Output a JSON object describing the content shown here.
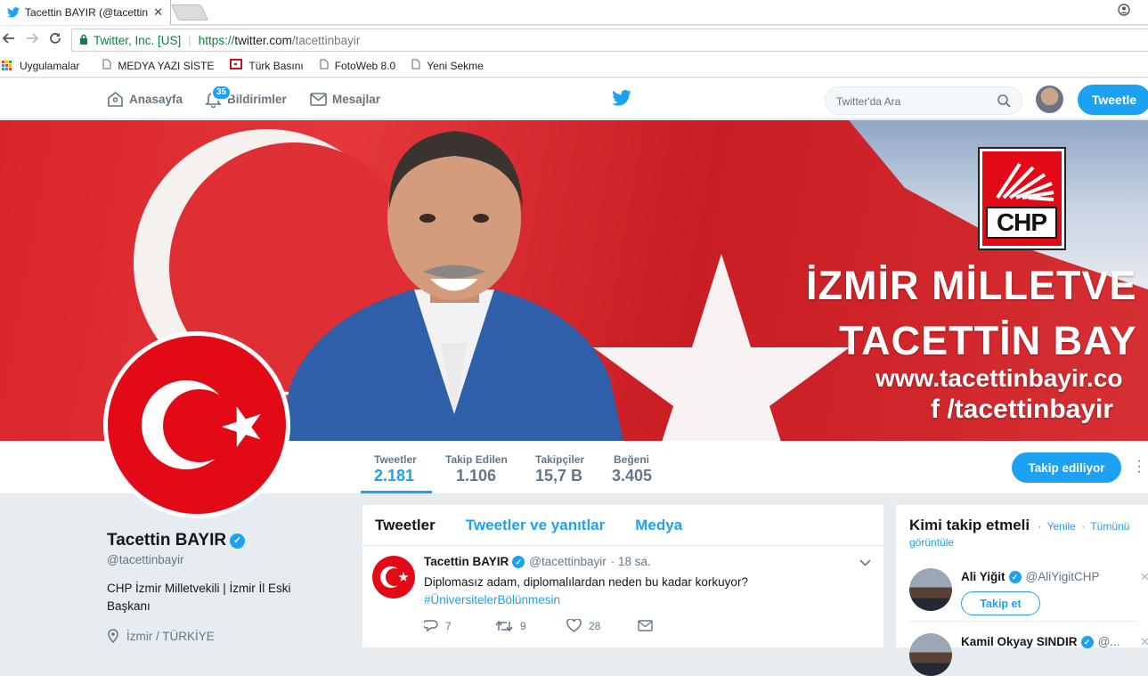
{
  "browser": {
    "tab_title": "Tacettin BAYIR (@tacettinbayir) | Twitter",
    "tab_close": "✕",
    "origin_label": "Twitter, Inc. [US]",
    "url_scheme": "https://",
    "url_host": "twitter.com",
    "url_path": "/tacettinbayir",
    "bookmarks": [
      {
        "label": "Uygulamalar",
        "icon": "apps-grid-icon"
      },
      {
        "label": "MEDYA YAZI SİSTEM",
        "icon": "page-icon"
      },
      {
        "label": "Türk Basını",
        "icon": "red-bookmark-icon"
      },
      {
        "label": "FotoWeb 8.0",
        "icon": "page-icon"
      },
      {
        "label": "Yeni Sekme",
        "icon": "page-icon"
      }
    ]
  },
  "twitter_nav": {
    "home": "Anasayfa",
    "notifications": "Bildirimler",
    "notifications_count": "35",
    "messages": "Mesajlar",
    "search_placeholder": "Twitter'da Ara",
    "tweet_button": "Tweetle"
  },
  "banner": {
    "line1": "İZMİR MİLLETVE",
    "line2": "TACETTİN BAY",
    "line3": "www.tacettinbayir.co",
    "line4": "f /tacettinbayir",
    "party_logo": "CHP"
  },
  "stats": [
    {
      "label": "Tweetler",
      "value": "2.181",
      "active": true
    },
    {
      "label": "Takip Edilen",
      "value": "1.106",
      "active": false
    },
    {
      "label": "Takipçiler",
      "value": "15,7 B",
      "active": false
    },
    {
      "label": "Beğeni",
      "value": "3.405",
      "active": false
    }
  ],
  "follow_button": "Takip ediliyor",
  "profile": {
    "name": "Tacettin BAYIR",
    "handle": "@tacettinbayir",
    "bio": "CHP İzmir Milletvekili | İzmir İl Eski Başkanı",
    "location": "İzmir / TÜRKİYE"
  },
  "timeline": {
    "tabs": [
      "Tweetler",
      "Tweetler ve yanıtlar",
      "Medya"
    ],
    "tweet": {
      "name": "Tacettin BAYIR",
      "handle": "@tacettinbayir",
      "time": "· 18 sa.",
      "text": "Diplomasız adam, diplomalılardan neden bu kadar korkuyor?",
      "hashtag": "#ÜniversitelerBölünmesin",
      "replies": "7",
      "retweets": "9",
      "likes": "28"
    }
  },
  "who_to_follow": {
    "title": "Kimi takip etmeli",
    "refresh": "Yenile",
    "view_all": "Tümünü görüntüle",
    "dot": "·",
    "suggestions": [
      {
        "name": "Ali Yiğit",
        "handle": "@AliYigitCHP",
        "button": "Takip et"
      },
      {
        "name": "Kamil Okyay SINDIR",
        "handle": "@..."
      }
    ]
  },
  "colors": {
    "accent": "#1da1f2",
    "flag_red": "#e30a17"
  }
}
